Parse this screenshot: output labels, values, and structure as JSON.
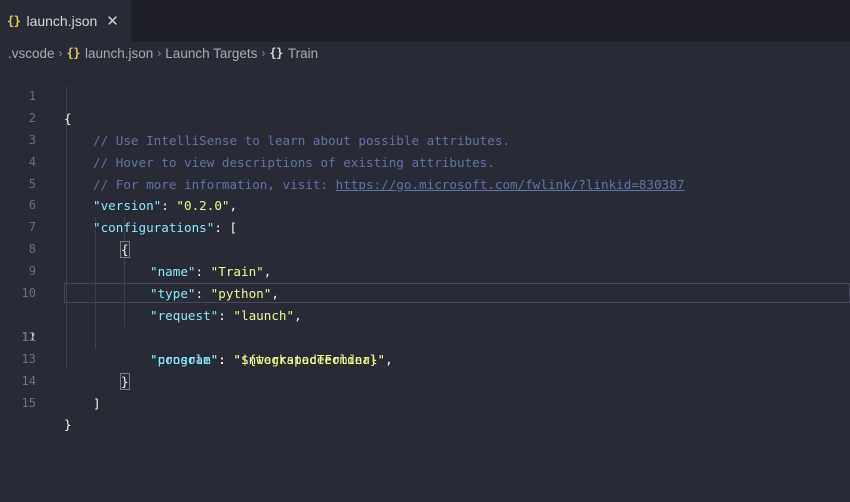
{
  "tab": {
    "icon": "{}",
    "label": "launch.json",
    "close": "✕"
  },
  "breadcrumb": {
    "items": [
      {
        "icon": "",
        "label": ".vscode"
      },
      {
        "icon": "{}",
        "label": "launch.json"
      },
      {
        "icon": "",
        "label": "Launch Targets"
      },
      {
        "icon": "{}",
        "label": "Train"
      }
    ],
    "separator": "›"
  },
  "editor": {
    "active_line": 11,
    "lines": [
      {
        "n": "1",
        "t": "{"
      },
      {
        "n": "2",
        "t": "// Use IntelliSense to learn about possible attributes."
      },
      {
        "n": "3",
        "t": "// Hover to view descriptions of existing attributes."
      },
      {
        "n": "4",
        "t": "// For more information, visit: ",
        "link": "https://go.microsoft.com/fwlink/?linkid=830387"
      },
      {
        "n": "5",
        "key": "\"version\"",
        "val": "\"0.2.0\"",
        "tail": ","
      },
      {
        "n": "6",
        "key": "\"configurations\"",
        "tail": ": ["
      },
      {
        "n": "7",
        "t": "{"
      },
      {
        "n": "8",
        "key": "\"name\"",
        "val": "\"Train\"",
        "tail": ","
      },
      {
        "n": "9",
        "key": "\"type\"",
        "val": "\"python\"",
        "tail": ","
      },
      {
        "n": "10",
        "key": "\"request\"",
        "val": "\"launch\"",
        "tail": ","
      },
      {
        "n": "11",
        "key": "\"program\"",
        "val": "\"${workspaceFolder}\"",
        "tail": ","
      },
      {
        "n": "12",
        "key": "\"console\"",
        "val": "\"integratedTerminal\"",
        "tail": ""
      },
      {
        "n": "13",
        "t": "}"
      },
      {
        "n": "14",
        "t": "]"
      },
      {
        "n": "15",
        "t": "}"
      }
    ]
  },
  "colors": {
    "background": "#282a36",
    "comment": "#6272a4",
    "key": "#8be9fd",
    "string": "#f1fa8c",
    "json_icon": "#e2c95e"
  }
}
